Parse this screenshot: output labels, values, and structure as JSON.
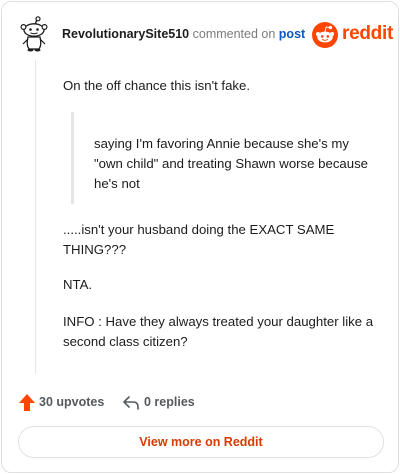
{
  "header": {
    "username": "RevolutionarySite510",
    "action_text": "commented on",
    "post_link": "post",
    "brand_word": "reddit",
    "avatar_icon": "snoo-avatar-icon",
    "brand_icon": "reddit-logo-icon"
  },
  "comment": {
    "paragraph_1": "On the off chance this isn't fake.",
    "quote": "saying I'm favoring Annie because she's my \"own child\" and treating Shawn worse because he's not",
    "paragraph_2": ".....isn't your husband doing the EXACT SAME THING???",
    "paragraph_3": "NTA.",
    "paragraph_4": "INFO : Have they always treated your daughter like a second class citizen?"
  },
  "footer": {
    "upvotes_label": "30 upvotes",
    "replies_label": "0 replies",
    "view_more_label": "View more on Reddit",
    "upvote_icon": "upvote-arrow-icon",
    "reply_icon": "reply-arrow-icon"
  },
  "colors": {
    "brand": "#ff4500",
    "link": "#0a57c2",
    "view_more_text": "#d93a00",
    "muted": "#7c7c7c"
  }
}
